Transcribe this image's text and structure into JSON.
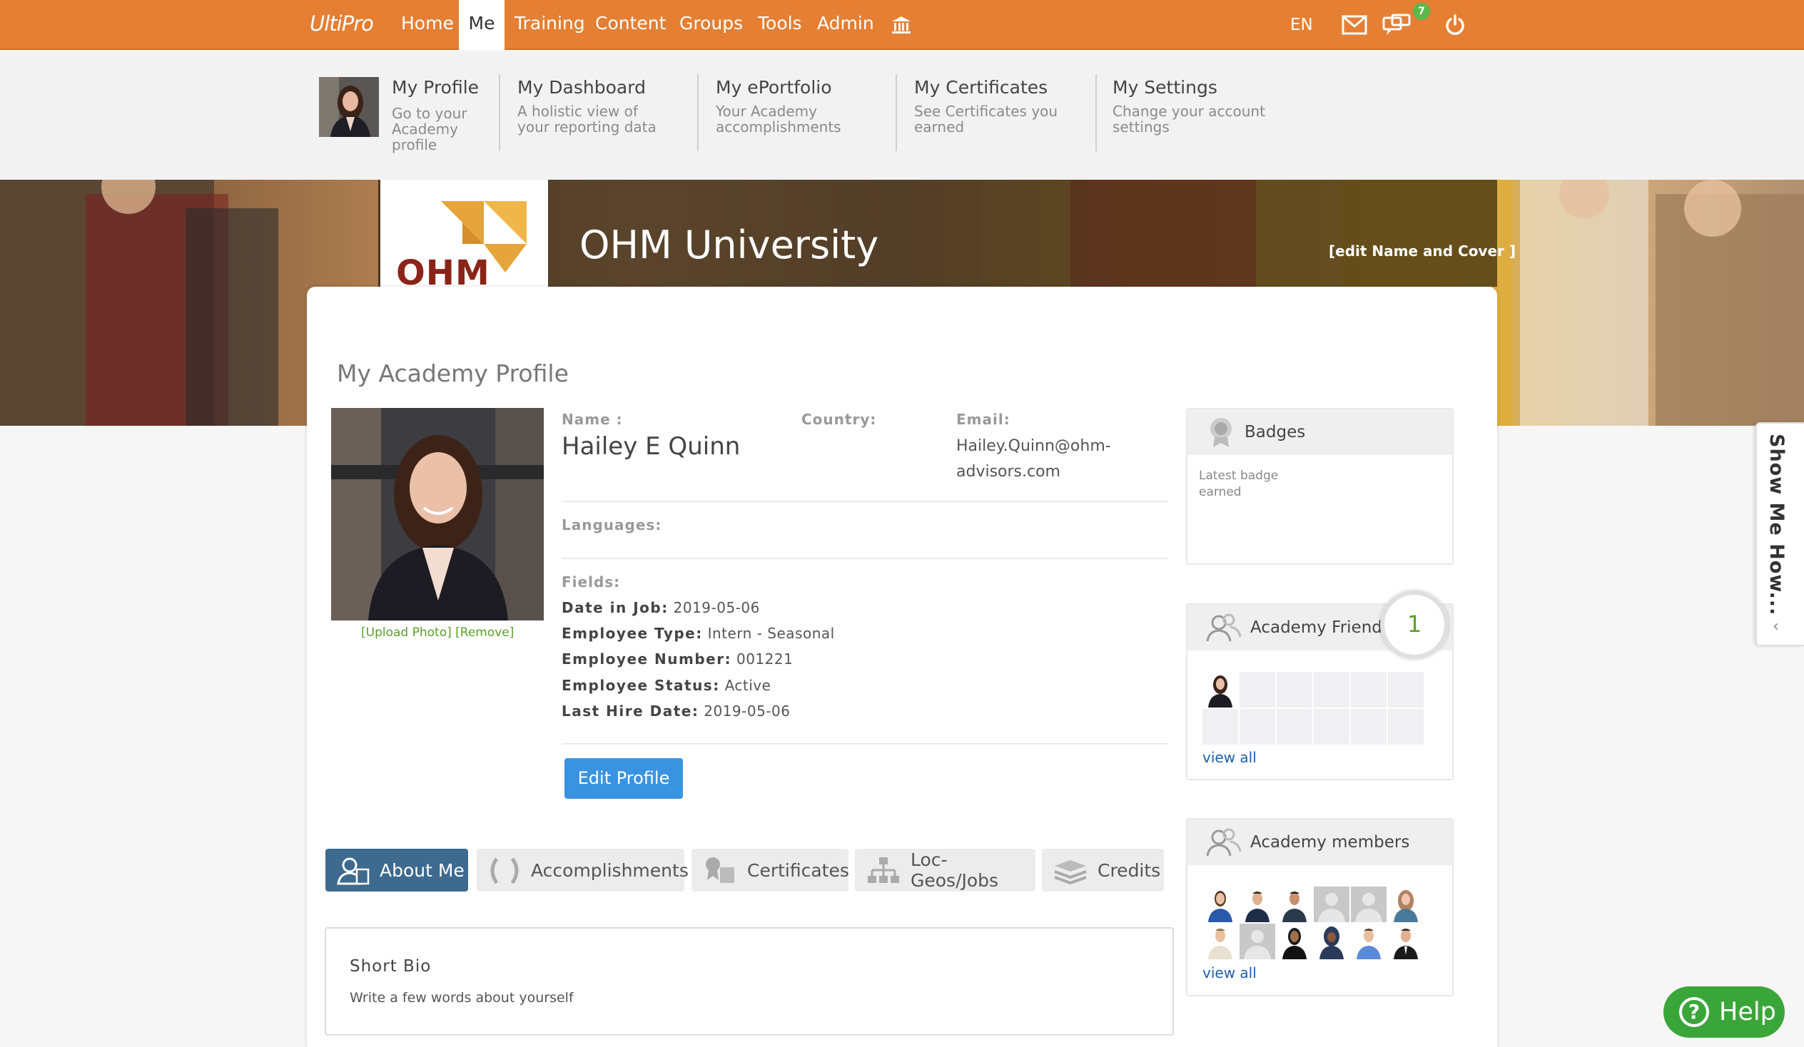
{
  "topnav": {
    "brand": "UltiPro",
    "items": [
      "Home",
      "Me",
      "Training",
      "Content",
      "Groups",
      "Tools",
      "Admin"
    ],
    "active": "Me",
    "language": "EN",
    "notification_count": "7"
  },
  "submenu": [
    {
      "title": "My Profile",
      "desc": "Go to your Academy profile"
    },
    {
      "title": "My Dashboard",
      "desc": "A holistic view of your reporting data"
    },
    {
      "title": "My ePortfolio",
      "desc": "Your Academy accomplishments"
    },
    {
      "title": "My Certificates",
      "desc": "See Certificates you earned"
    },
    {
      "title": "My Settings",
      "desc": "Change your account settings"
    }
  ],
  "cover": {
    "university": "OHM University",
    "edit_link": "[edit Name and Cover ]",
    "logo_text": "OHM"
  },
  "profile": {
    "title": "My Academy Profile",
    "photo_link": "[Upload Photo] [Remove]",
    "name_label": "Name :",
    "name": "Hailey E Quinn",
    "country_label": "Country:",
    "email_label": "Email:",
    "email": "Hailey.Quinn@ohm-advisors.com",
    "languages_label": "Languages:",
    "fields_label": "Fields:",
    "fields": [
      {
        "label": "Date in Job:",
        "value": "2019-05-06"
      },
      {
        "label": "Employee Type:",
        "value": "Intern - Seasonal"
      },
      {
        "label": "Employee Number:",
        "value": "001221"
      },
      {
        "label": "Employee Status:",
        "value": "Active"
      },
      {
        "label": "Last Hire Date:",
        "value": "2019-05-06"
      }
    ],
    "edit_button": "Edit Profile"
  },
  "tabs": [
    "About Me",
    "Accomplishments",
    "Certificates",
    "Loc-Geos/Jobs",
    "Credits"
  ],
  "bio": {
    "title": "Short Bio",
    "text": "Write a few words about yourself"
  },
  "badges": {
    "title": "Badges",
    "subtitle": "Latest badge earned"
  },
  "friends": {
    "title": "Academy Friends",
    "count": "1",
    "view_all": "view all"
  },
  "members": {
    "title": "Academy members",
    "view_all": "view all"
  },
  "showme": "Show Me How...",
  "help": "Help",
  "colors": {
    "nav": "#e47f33",
    "accent_green": "#5aa02c",
    "button_blue": "#3a93e0",
    "active_tab": "#3d6a8e",
    "help_green": "#3aa63a"
  }
}
